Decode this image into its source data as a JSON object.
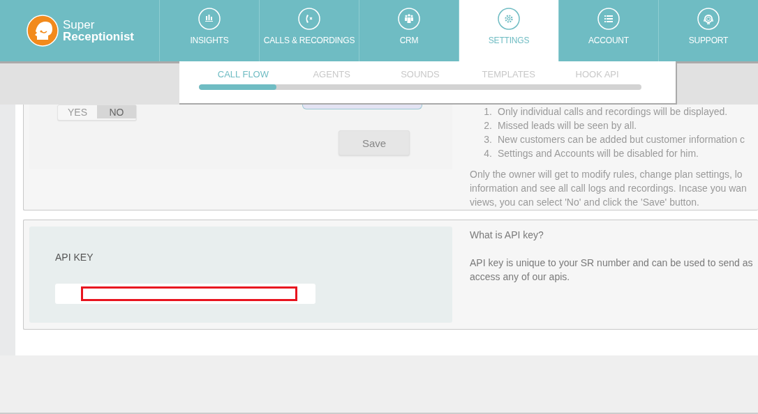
{
  "brand": {
    "line1": "Super",
    "line2": "Receptionist"
  },
  "nav": [
    {
      "label": "INSIGHTS",
      "selected": false
    },
    {
      "label": "CALLS & RECORDINGS",
      "selected": false
    },
    {
      "label": "CRM",
      "selected": false
    },
    {
      "label": "SETTINGS",
      "selected": true
    },
    {
      "label": "ACCOUNT",
      "selected": false
    },
    {
      "label": "SUPPORT",
      "selected": false
    }
  ],
  "subnav": {
    "items": [
      {
        "label": "CALL FLOW",
        "selected": true
      },
      {
        "label": "AGENTS",
        "selected": false
      },
      {
        "label": "SOUNDS",
        "selected": false
      },
      {
        "label": "TEMPLATES",
        "selected": false
      },
      {
        "label": "HOOK API",
        "selected": false
      }
    ],
    "level": 0.175
  },
  "access_card": {
    "toggle": [
      {
        "label": "YES",
        "selected": false
      },
      {
        "label": "NO",
        "selected": true
      }
    ],
    "save_button": "Save",
    "rules": [
      {
        "number": "1.",
        "text": "Only individual calls and recordings will be displayed."
      },
      {
        "number": "2.",
        "text": "Missed leads will be seen by all."
      },
      {
        "number": "3.",
        "text": "New customers can be added but customer information c"
      },
      {
        "number": "4.",
        "text": "Settings and Accounts will be disabled for him."
      }
    ],
    "note_lines": [
      "Only the owner will get to modify rules, change plan settings, lo",
      "information and see all call logs and recordings. Incase you wan",
      "views, you can select 'No' and click the 'Save' button."
    ]
  },
  "api_card": {
    "label": "API KEY",
    "help_title": "What is API key?",
    "help_lines": [
      "API key is unique to your SR number and can be used to send as",
      "access any of our apis."
    ]
  }
}
